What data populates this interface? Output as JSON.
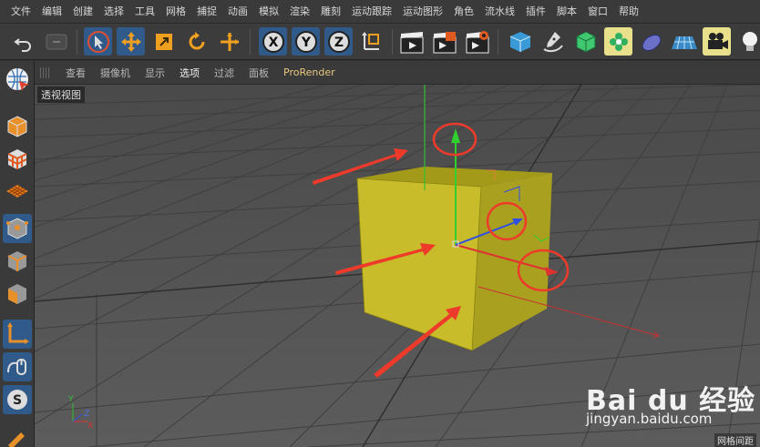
{
  "menu": [
    "文件",
    "编辑",
    "创建",
    "选择",
    "工具",
    "网格",
    "捕捉",
    "动画",
    "模拟",
    "渲染",
    "雕刻",
    "运动跟踪",
    "运动图形",
    "角色",
    "流水线",
    "插件",
    "脚本",
    "窗口",
    "帮助"
  ],
  "toolbar": {
    "undo": "undo-icon",
    "redo": "redo-icon",
    "axis_x": "X",
    "axis_y": "Y",
    "axis_z": "Z"
  },
  "viewport": {
    "tabs": [
      "查看",
      "摄像机",
      "显示",
      "选项",
      "过滤",
      "面板",
      "ProRender"
    ],
    "active_tab": "选项",
    "label": "透视视图",
    "axis_y": "Y",
    "axis_x": "X",
    "axis_z": "Z",
    "bottom_hint": "网格间距"
  },
  "watermark": {
    "logo": "Bai du 经验",
    "url": "jingyan.baidu.com"
  },
  "colors": {
    "cube": "#c8bc2a",
    "x_axis": "#e04040",
    "y_axis": "#30c030",
    "z_axis": "#3050e0",
    "annotation": "#ee3a2a",
    "selected_tool": "#2f5a8a"
  }
}
